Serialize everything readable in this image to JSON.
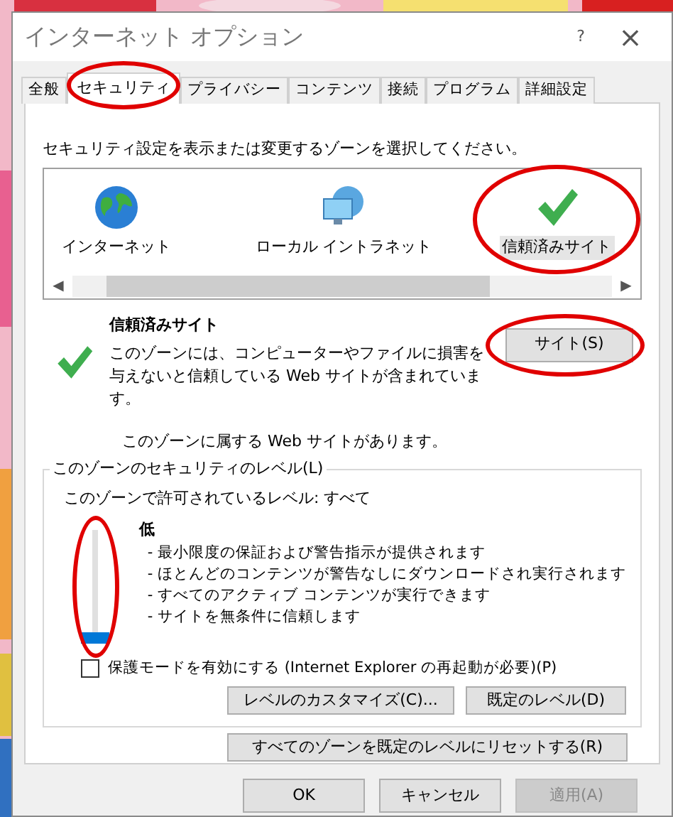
{
  "window": {
    "title": "インターネット オプション",
    "help": "?",
    "close": "×"
  },
  "tabs": [
    {
      "label": "全般",
      "selected": false,
      "circled": false
    },
    {
      "label": "セキュリティ",
      "selected": true,
      "circled": true
    },
    {
      "label": "プライバシー",
      "selected": false,
      "circled": false
    },
    {
      "label": "コンテンツ",
      "selected": false,
      "circled": false
    },
    {
      "label": "接続",
      "selected": false,
      "circled": false
    },
    {
      "label": "プログラム",
      "selected": false,
      "circled": false
    },
    {
      "label": "詳細設定",
      "selected": false,
      "circled": false
    }
  ],
  "zone_prompt": "セキュリティ設定を表示または変更するゾーンを選択してください。",
  "scroll_arrows": [
    "◀",
    "▶"
  ],
  "zones": [
    {
      "label": "インターネット",
      "kind": "globe",
      "selected": false,
      "circled": false
    },
    {
      "label": "ローカル イントラネット",
      "kind": "intranet",
      "selected": false,
      "circled": false
    },
    {
      "label": "信頼済みサイト",
      "kind": "trusted",
      "selected": true,
      "circled": true
    }
  ],
  "zone_info": {
    "title": "信頼済みサイト",
    "description": "このゾーンには、コンピューターやファイルに損害を与えないと信頼している Web サイトが含まれています。",
    "sites_note": "このゾーンに属する Web サイトがあります。",
    "sites_button": {
      "label": "サイト(S)",
      "circled": true
    }
  },
  "security_level": {
    "legend": "このゾーンのセキュリティのレベル(L)",
    "allowed": "このゾーンで許可されているレベル: すべて",
    "level_name": "低",
    "level": 0,
    "circled": true,
    "details": [
      "- 最小限度の保証および警告指示が提供されます",
      "- ほとんどのコンテンツが警告なしにダウンロードされ実行されます",
      "- すべてのアクティブ コンテンツが実行できます",
      "- サイトを無条件に信頼します"
    ],
    "protected_mode": {
      "label": "保護モードを有効にする (Internet Explorer の再起動が必要)(P)",
      "checked": false
    },
    "buttons": [
      "レベルのカスタマイズ(C)...",
      "既定のレベル(D)"
    ]
  },
  "reset_button": "すべてのゾーンを既定のレベルにリセットする(R)",
  "footer_buttons": [
    {
      "label": "OK",
      "disabled": false
    },
    {
      "label": "キャンセル",
      "disabled": false
    },
    {
      "label": "適用(A)",
      "disabled": true
    }
  ]
}
